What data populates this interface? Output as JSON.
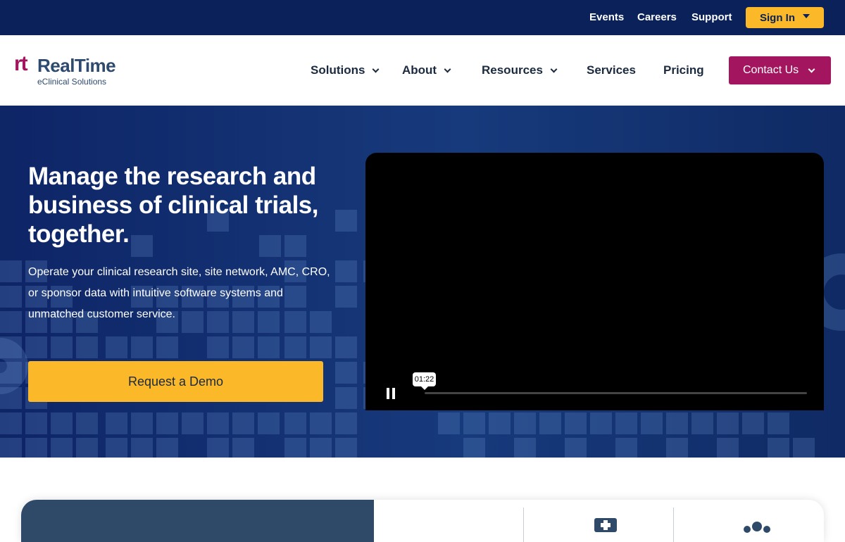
{
  "topbar": {
    "links": [
      "Events",
      "Careers",
      "Support"
    ],
    "signin_label": "Sign In"
  },
  "logo": {
    "mark": "rt",
    "name": "RealTime",
    "tagline": "eClinical Solutions"
  },
  "nav": {
    "items": [
      "Solutions",
      "About",
      "Resources",
      "Services",
      "Pricing"
    ],
    "contact_label": "Contact Us"
  },
  "hero": {
    "title": "Manage the research and business of clinical trials, together.",
    "subtitle": "Operate your clinical research site, site network, AMC, CRO, or sponsor data with intuitive software systems and unmatched customer service.",
    "cta_label": "Request a Demo"
  },
  "video": {
    "time": "01:22"
  },
  "colors": {
    "topbar": "#0a2259",
    "accent_yellow": "#fbb829",
    "brand_magenta": "#a3155f",
    "navy_text": "#1b2a3f"
  }
}
